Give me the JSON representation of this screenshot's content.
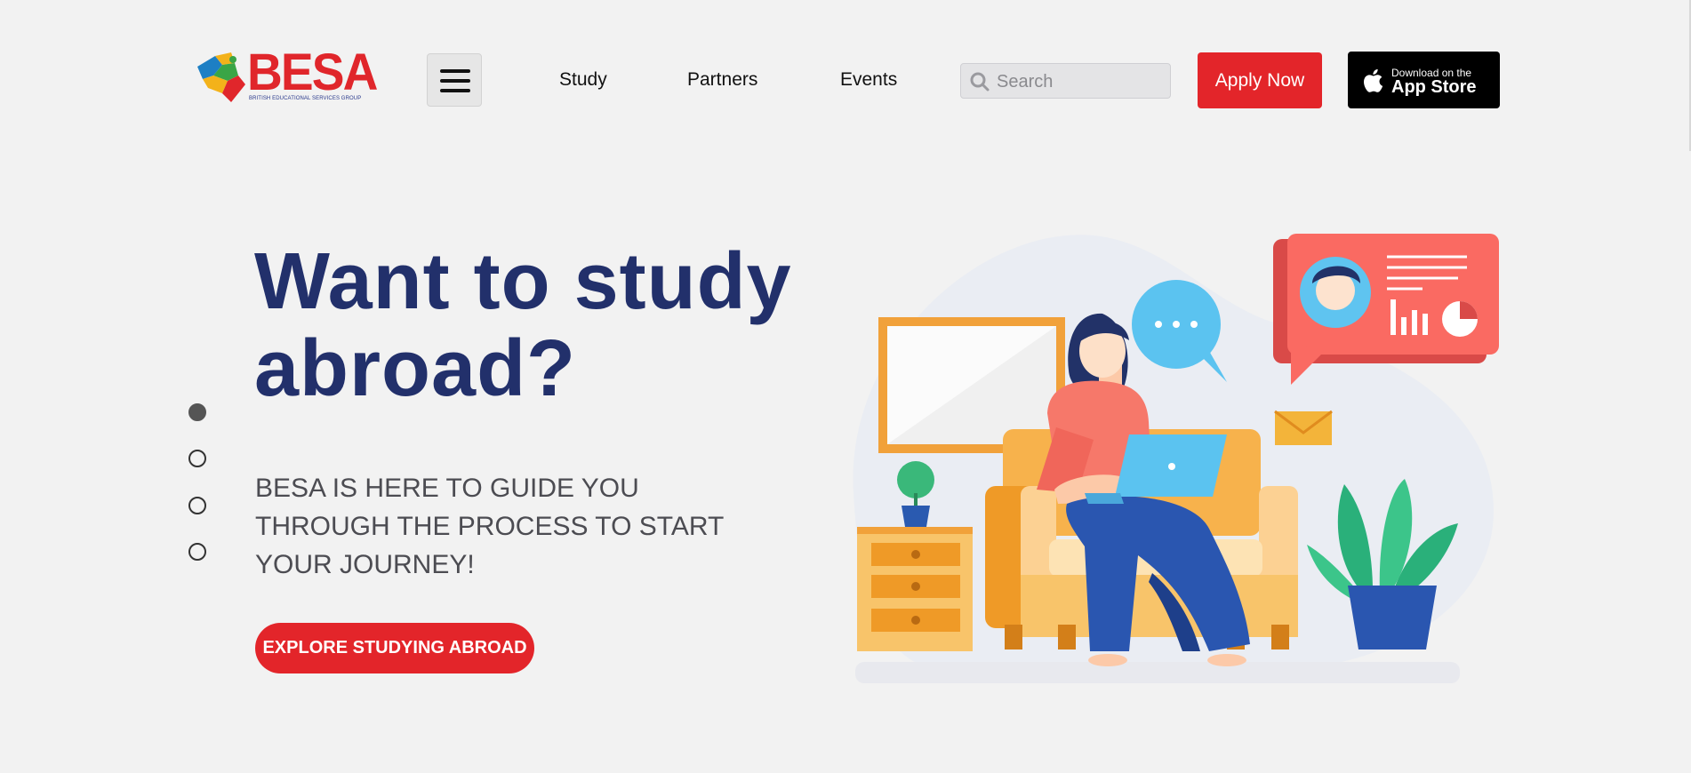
{
  "header": {
    "logo": {
      "brand": "BESA",
      "subtitle": "BRITISH EDUCATIONAL SERVICES GROUP"
    },
    "nav": [
      {
        "label": "Study"
      },
      {
        "label": "Partners"
      },
      {
        "label": "Events"
      }
    ],
    "search": {
      "placeholder": "Search",
      "value": ""
    },
    "apply_label": "Apply Now",
    "app_store": {
      "small": "Download on the",
      "big": "App Store"
    }
  },
  "hero": {
    "title": "Want to study abroad?",
    "subtitle": "BESA IS HERE TO GUIDE YOU THROUGH THE PROCESS TO START YOUR JOURNEY!",
    "cta_label": "EXPLORE STUDYING ABROAD",
    "slides": {
      "count": 4,
      "active": 1
    }
  },
  "colors": {
    "accent": "#e3252a",
    "title": "#22306b",
    "background": "#f2f2f2"
  },
  "icons": [
    "puzzle-logo-icon",
    "hamburger-icon",
    "search-icon",
    "apple-icon"
  ]
}
